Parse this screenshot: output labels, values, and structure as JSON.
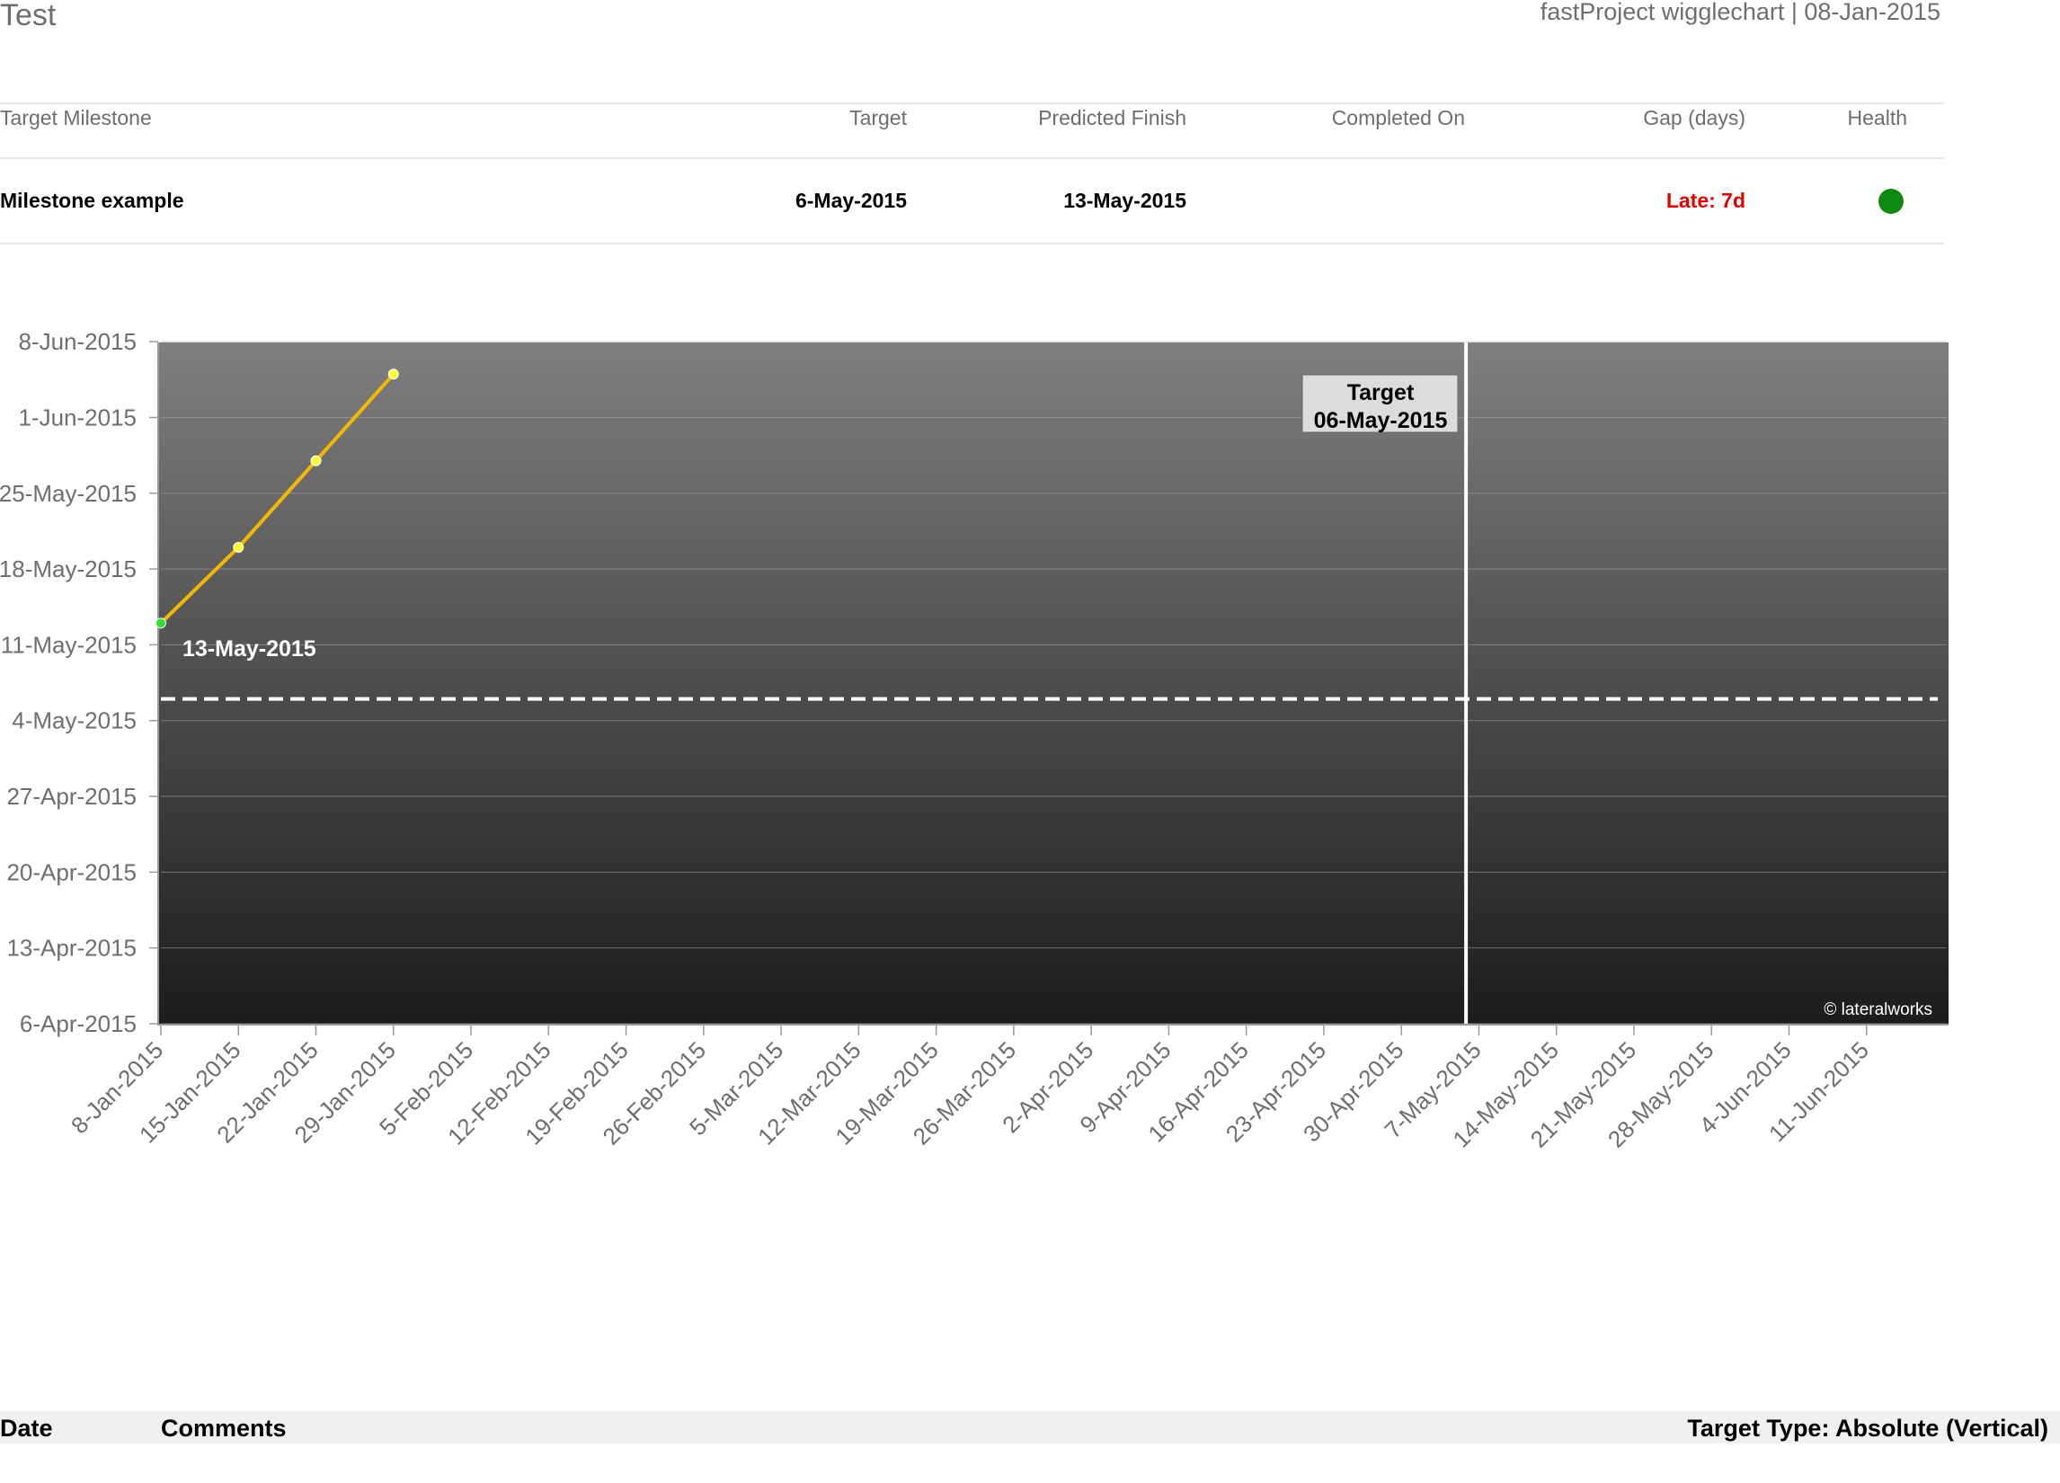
{
  "header": {
    "title": "Test",
    "app_info": "fastProject wigglechart | 08-Jan-2015"
  },
  "table": {
    "columns": [
      "Target Milestone",
      "Target",
      "Predicted Finish",
      "Completed On",
      "Gap (days)",
      "Health"
    ],
    "row": {
      "milestone": "Milestone example",
      "target": "6-May-2015",
      "predicted": "13-May-2015",
      "completed": "",
      "gap": "Late: 7d",
      "health_color": "#0f8a10"
    },
    "gap_color": "#e00000"
  },
  "chart_data": {
    "type": "line",
    "x_axis": {
      "type": "date",
      "min": "2015-01-08",
      "max": "2015-06-18",
      "tick_labels": [
        "8-Jan-2015",
        "15-Jan-2015",
        "22-Jan-2015",
        "29-Jan-2015",
        "5-Feb-2015",
        "12-Feb-2015",
        "19-Feb-2015",
        "26-Feb-2015",
        "5-Mar-2015",
        "12-Mar-2015",
        "19-Mar-2015",
        "26-Mar-2015",
        "2-Apr-2015",
        "9-Apr-2015",
        "16-Apr-2015",
        "23-Apr-2015",
        "30-Apr-2015",
        "7-May-2015",
        "14-May-2015",
        "21-May-2015",
        "28-May-2015",
        "4-Jun-2015",
        "11-Jun-2015"
      ]
    },
    "y_axis": {
      "type": "date",
      "min": "2015-04-06",
      "max": "2015-06-11",
      "tick_labels": [
        "6-Apr-2015",
        "13-Apr-2015",
        "20-Apr-2015",
        "27-Apr-2015",
        "4-May-2015",
        "11-May-2015",
        "18-May-2015",
        "25-May-2015",
        "1-Jun-2015",
        "8-Jun-2015"
      ]
    },
    "series": [
      {
        "color": "#f5b800",
        "points": [
          {
            "x": "2015-01-08",
            "y": "2015-05-13"
          },
          {
            "x": "2015-01-15",
            "y": "2015-05-20"
          },
          {
            "x": "2015-01-22",
            "y": "2015-05-28"
          },
          {
            "x": "2015-01-29",
            "y": "2015-06-05"
          }
        ],
        "first_point_color": "#33dd33",
        "point_color": "#ffff33"
      }
    ],
    "point_label": "13-May-2015",
    "target_date": "2015-05-06",
    "target_label_title": "Target",
    "target_label_date": "06-May-2015",
    "watermark": "© lateralworks",
    "grid": true
  },
  "footer": {
    "date_label": "Date",
    "comments_label": "Comments",
    "target_type": "Target Type: Absolute (Vertical)"
  }
}
